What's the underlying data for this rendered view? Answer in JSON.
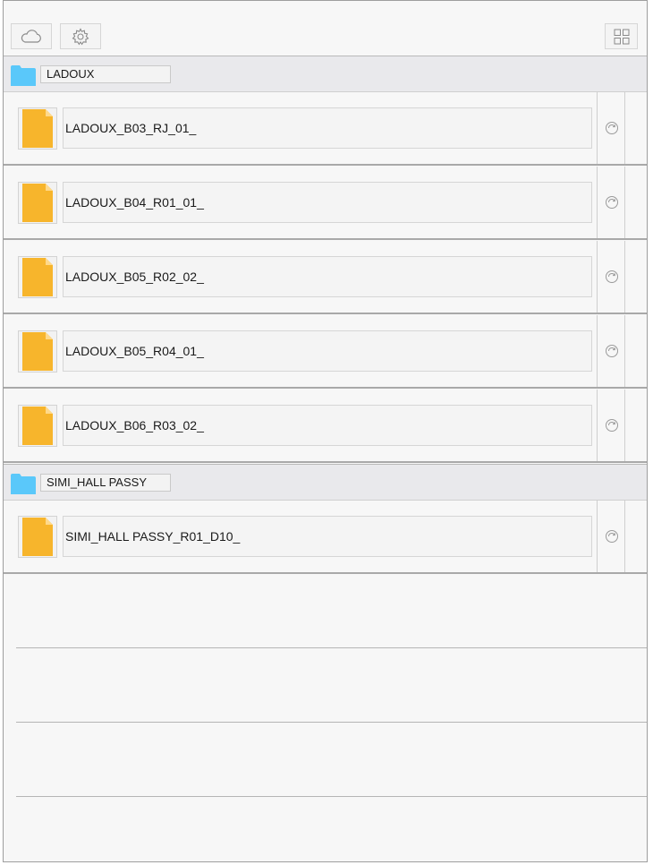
{
  "toolbar": {
    "cloud_icon": "cloud-icon",
    "settings_icon": "gear-icon",
    "layout_icon": "grid-icon"
  },
  "colors": {
    "folder": "#5ac8fa",
    "document": "#f7b52c",
    "background": "#f7f7f7",
    "folder_row": "#e9e9ec"
  },
  "groups": [
    {
      "folder": "LADOUX",
      "files": [
        "LADOUX_B03_RJ_01_",
        "LADOUX_B04_R01_01_",
        "LADOUX_B05_R02_02_",
        "LADOUX_B05_R04_01_",
        "LADOUX_B06_R03_02_"
      ]
    },
    {
      "folder": "SIMI_HALL PASSY",
      "files": [
        "SIMI_HALL PASSY_R01_D10_"
      ]
    }
  ]
}
